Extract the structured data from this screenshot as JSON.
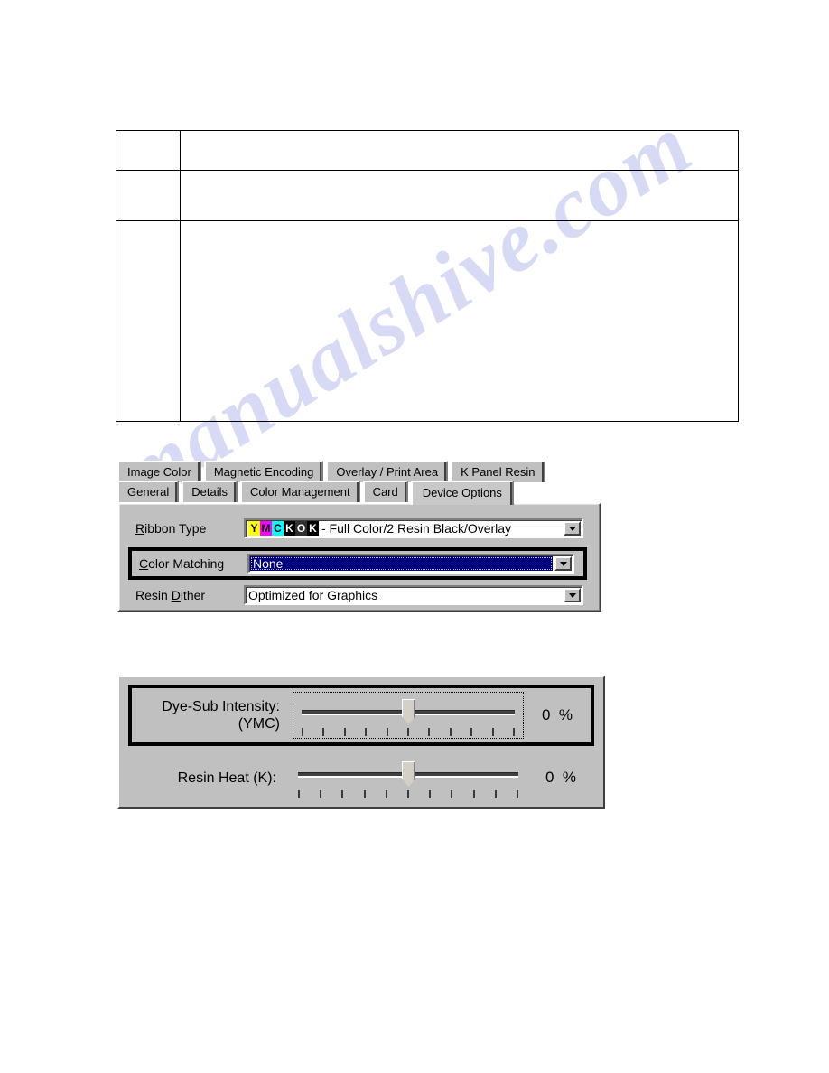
{
  "page": {
    "watermark": "manualshive.com"
  },
  "spec_table": {
    "rows": [
      {
        "cells": [
          {
            "text": ""
          },
          {
            "text": ""
          }
        ]
      },
      {
        "cells": [
          {
            "text": ""
          },
          {
            "text": ""
          }
        ]
      },
      {
        "cells": [
          {
            "text": ""
          },
          {
            "text": ""
          }
        ]
      }
    ]
  },
  "printer_dialog": {
    "tabs_row1": [
      {
        "label": "Image Color",
        "active": false
      },
      {
        "label": "Magnetic Encoding",
        "active": false
      },
      {
        "label": "Overlay / Print Area",
        "active": false
      },
      {
        "label": "K Panel Resin",
        "active": false
      }
    ],
    "tabs_row2": [
      {
        "label": "General",
        "active": false
      },
      {
        "label": "Details",
        "active": false
      },
      {
        "label": "Color Management",
        "active": false
      },
      {
        "label": "Card",
        "active": false
      },
      {
        "label": "Device Options",
        "active": true
      }
    ],
    "fields": {
      "ribbon_type": {
        "label_accel": "R",
        "label_rest": "ibbon Type",
        "swatches": [
          {
            "letter": "Y",
            "bg": "#ffff00",
            "fg": "#000000"
          },
          {
            "letter": "M",
            "bg": "#ff00ff",
            "fg": "#000000"
          },
          {
            "letter": "C",
            "bg": "#00ffff",
            "fg": "#000000"
          },
          {
            "letter": "K",
            "bg": "#000000",
            "fg": "#ffffff"
          },
          {
            "letter": "O",
            "bg": "#303030",
            "fg": "#ffffff"
          },
          {
            "letter": "K",
            "bg": "#000000",
            "fg": "#ffffff"
          }
        ],
        "value_text": " - Full Color/2 Resin Black/Overlay"
      },
      "color_matching": {
        "label_accel": "C",
        "label_rest": "olor Matching",
        "value": "None",
        "selected": true,
        "highlighted": true
      },
      "resin_dither": {
        "label_pre": "Resin ",
        "label_accel": "D",
        "label_rest": "ither",
        "value": "Optimized for Graphics"
      }
    }
  },
  "slider_dialog": {
    "sliders": [
      {
        "label_line1": "Dye-Sub Intensity:",
        "label_line2": "(YMC)",
        "value": "0",
        "unit": "%",
        "position_percent": 50,
        "tick_count": 11,
        "highlighted": true,
        "focused": true
      },
      {
        "label_line1": "Resin Heat  (K):",
        "label_line2": "",
        "value": "0",
        "unit": "%",
        "position_percent": 50,
        "tick_count": 11,
        "highlighted": false,
        "focused": false
      }
    ]
  },
  "colors": {
    "dialog_face": "#c0c0c0",
    "selection_navy": "#00007f",
    "highlight_border": "#000000",
    "watermark": "#c9cdf2"
  }
}
